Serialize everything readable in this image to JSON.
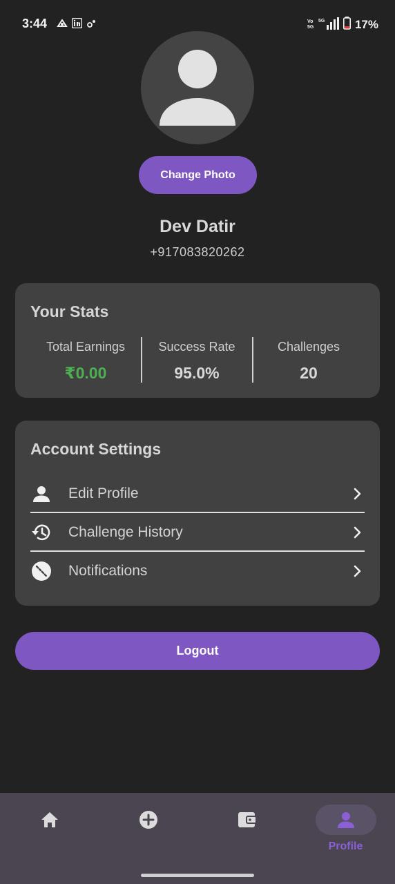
{
  "status_bar": {
    "time": "3:44",
    "battery": "17%",
    "network": "5G"
  },
  "profile": {
    "change_photo_label": "Change Photo",
    "name": "Dev Datir",
    "phone": "+917083820262"
  },
  "stats": {
    "title": "Your Stats",
    "items": [
      {
        "label": "Total Earnings",
        "value": "₹0.00",
        "color": "#4caf50"
      },
      {
        "label": "Success Rate",
        "value": "95.0%"
      },
      {
        "label": "Challenges",
        "value": "20"
      }
    ]
  },
  "settings": {
    "title": "Account Settings",
    "items": [
      {
        "label": "Edit Profile",
        "icon": "person-icon"
      },
      {
        "label": "Challenge History",
        "icon": "history-icon"
      },
      {
        "label": "Notifications",
        "icon": "notifications-off-icon"
      }
    ]
  },
  "logout_label": "Logout",
  "bottom_nav": {
    "items": [
      {
        "label": "",
        "icon": "home-icon"
      },
      {
        "label": "",
        "icon": "add-circle-icon"
      },
      {
        "label": "",
        "icon": "wallet-icon"
      },
      {
        "label": "Profile",
        "icon": "person-icon",
        "active": true
      }
    ]
  },
  "colors": {
    "accent": "#7e57c2",
    "background": "#222222",
    "card": "#414141",
    "earnings_green": "#4caf50",
    "nav_bar": "#4a4550"
  }
}
